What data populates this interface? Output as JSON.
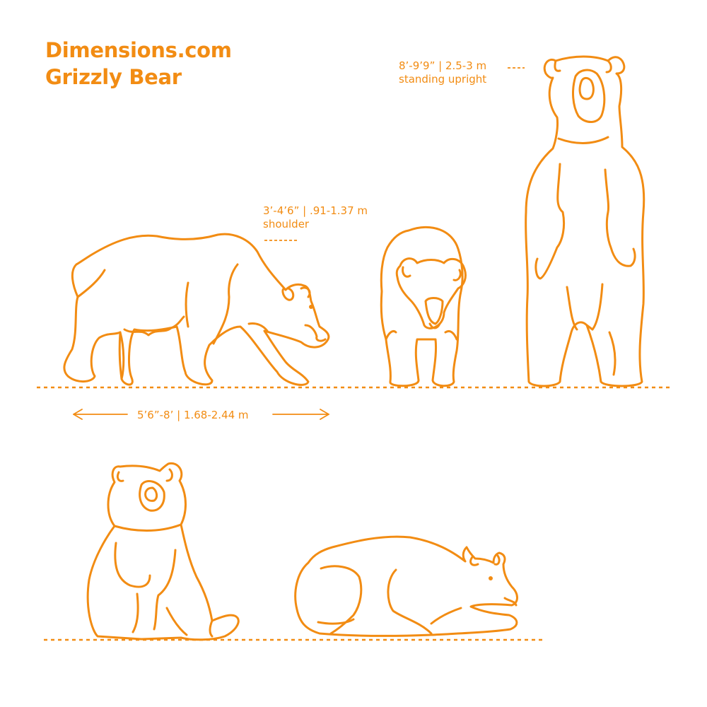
{
  "header": {
    "site": "Dimensions.com",
    "subject": "Grizzly Bear"
  },
  "annotations": {
    "standing_height": "8’-9’9” | 2.5-3 m",
    "standing_note": "standing upright",
    "shoulder_height": "3’-4’6” | .91-1.37 m",
    "shoulder_note": "shoulder",
    "body_length": "5’6”-8’ | 1.68-2.44 m"
  },
  "colors": {
    "accent": "#f28c13",
    "background": "#ffffff"
  }
}
